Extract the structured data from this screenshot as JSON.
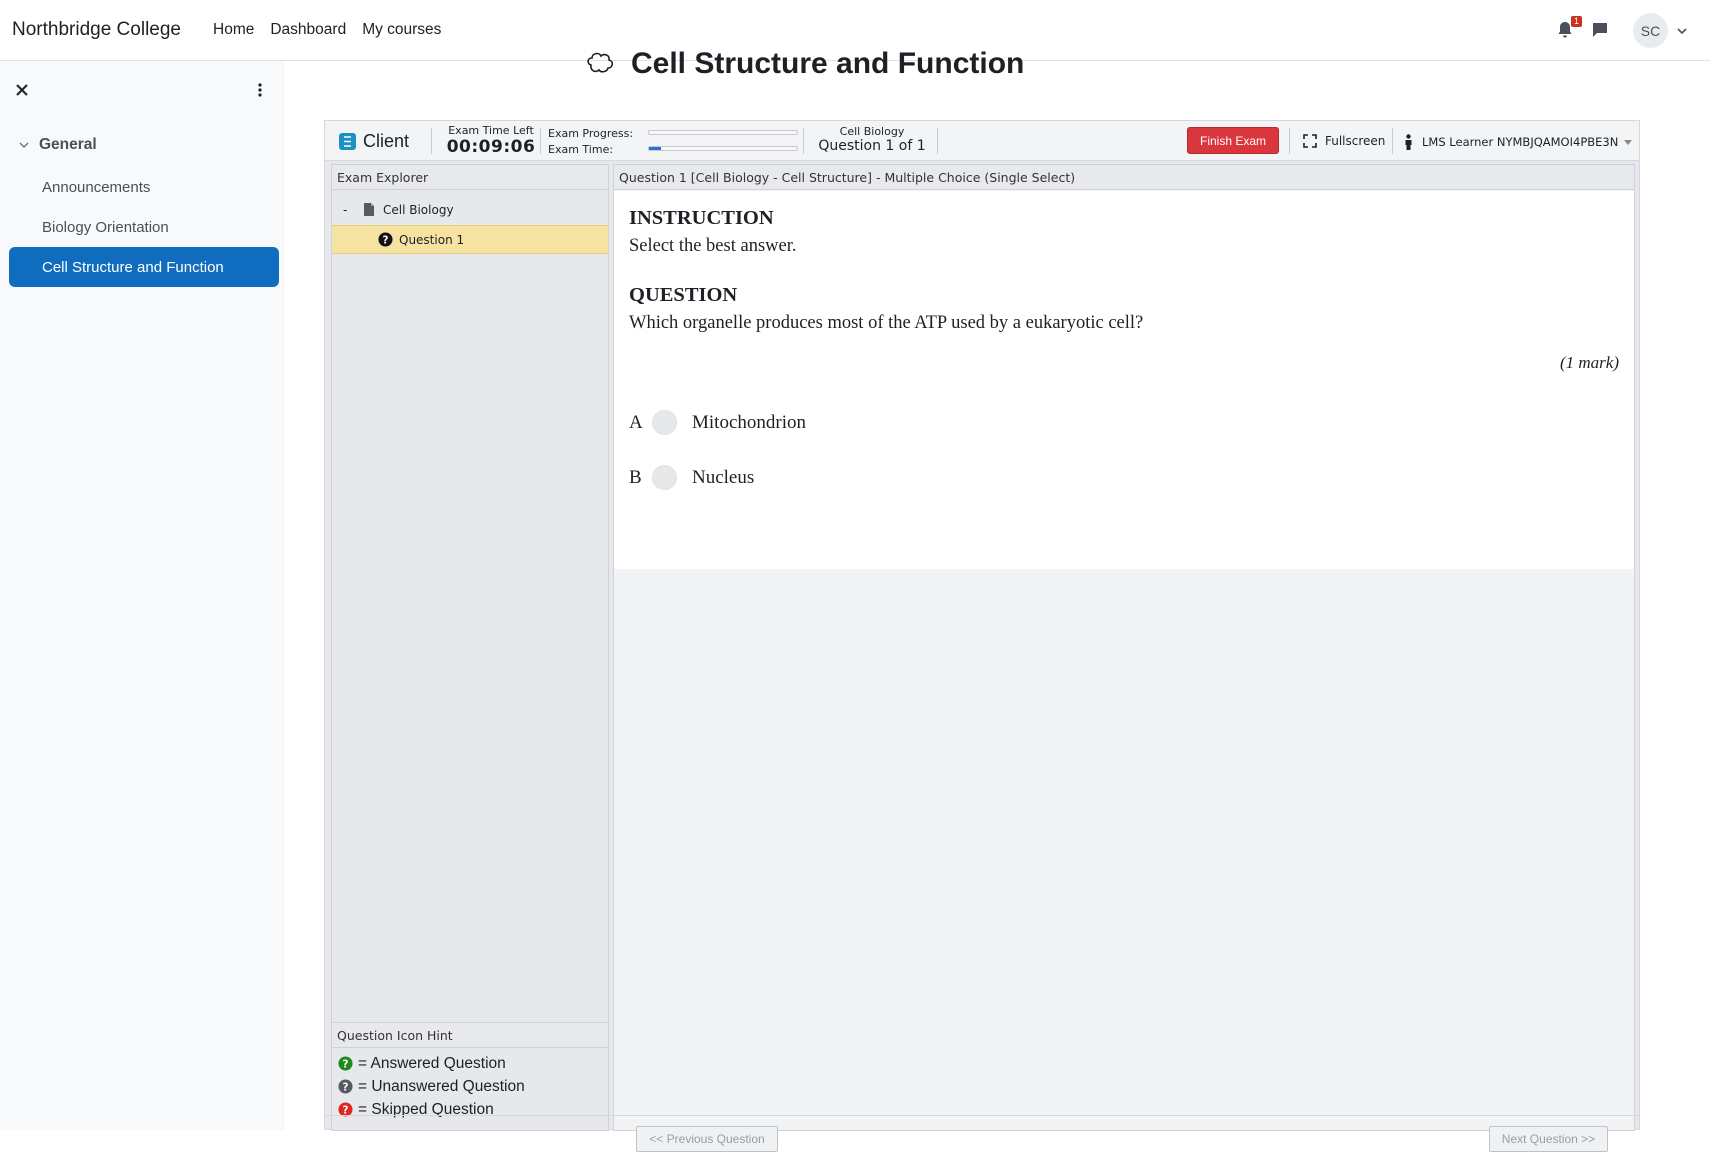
{
  "navbar": {
    "brand": "Northbridge College",
    "links": [
      "Home",
      "Dashboard",
      "My courses"
    ],
    "notification_count": "1",
    "avatar_initials": "SC",
    "icons": [
      "bell-icon",
      "chat-icon",
      "chevron-down-icon"
    ]
  },
  "drawer": {
    "section": "General",
    "items": [
      {
        "label": "Announcements",
        "active": false
      },
      {
        "label": "Biology Orientation",
        "active": false
      },
      {
        "label": "Cell Structure and Function",
        "active": true
      }
    ],
    "active_color": "#0f6cbf"
  },
  "page": {
    "title": "Cell Structure and Function"
  },
  "exam": {
    "client_label": "Client",
    "time_left_label": "Exam Time Left",
    "time_left": "00:09:06",
    "progress_label": "Exam Progress:",
    "progress_fraction": 0.0,
    "exam_time_label": "Exam Time:",
    "exam_time_fraction": 0.08,
    "section_name": "Cell Biology",
    "question_position": "Question 1 of 1",
    "finish_label": "Finish Exam",
    "finish_color": "#d9363e",
    "fullscreen_label": "Fullscreen",
    "learner": "LMS Learner NYMBJQAMOI4PBE3N"
  },
  "explorer": {
    "title": "Exam Explorer",
    "section_toggle": "-",
    "section": "Cell Biology",
    "question": "Question 1",
    "hint_title": "Question Icon Hint",
    "hints": [
      {
        "label": "= Answered Question",
        "color": "#1e8a1e"
      },
      {
        "label": "= Unanswered Question",
        "color": "#555b63"
      },
      {
        "label": "= Skipped Question",
        "color": "#e0261f"
      }
    ]
  },
  "question": {
    "header": "Question 1 [Cell Biology - Cell Structure] - Multiple Choice (Single Select)",
    "instruction_heading": "INSTRUCTION",
    "instruction_text": "Select the best answer.",
    "question_heading": "QUESTION",
    "question_text": "Which organelle produces most of the ATP used by a eukaryotic cell?",
    "marks": "(1 mark)",
    "options": [
      {
        "letter": "A",
        "text": "Mitochondrion"
      },
      {
        "letter": "B",
        "text": "Nucleus"
      }
    ],
    "prev_label": "<< Previous Question",
    "next_label": "Next Question >>"
  }
}
